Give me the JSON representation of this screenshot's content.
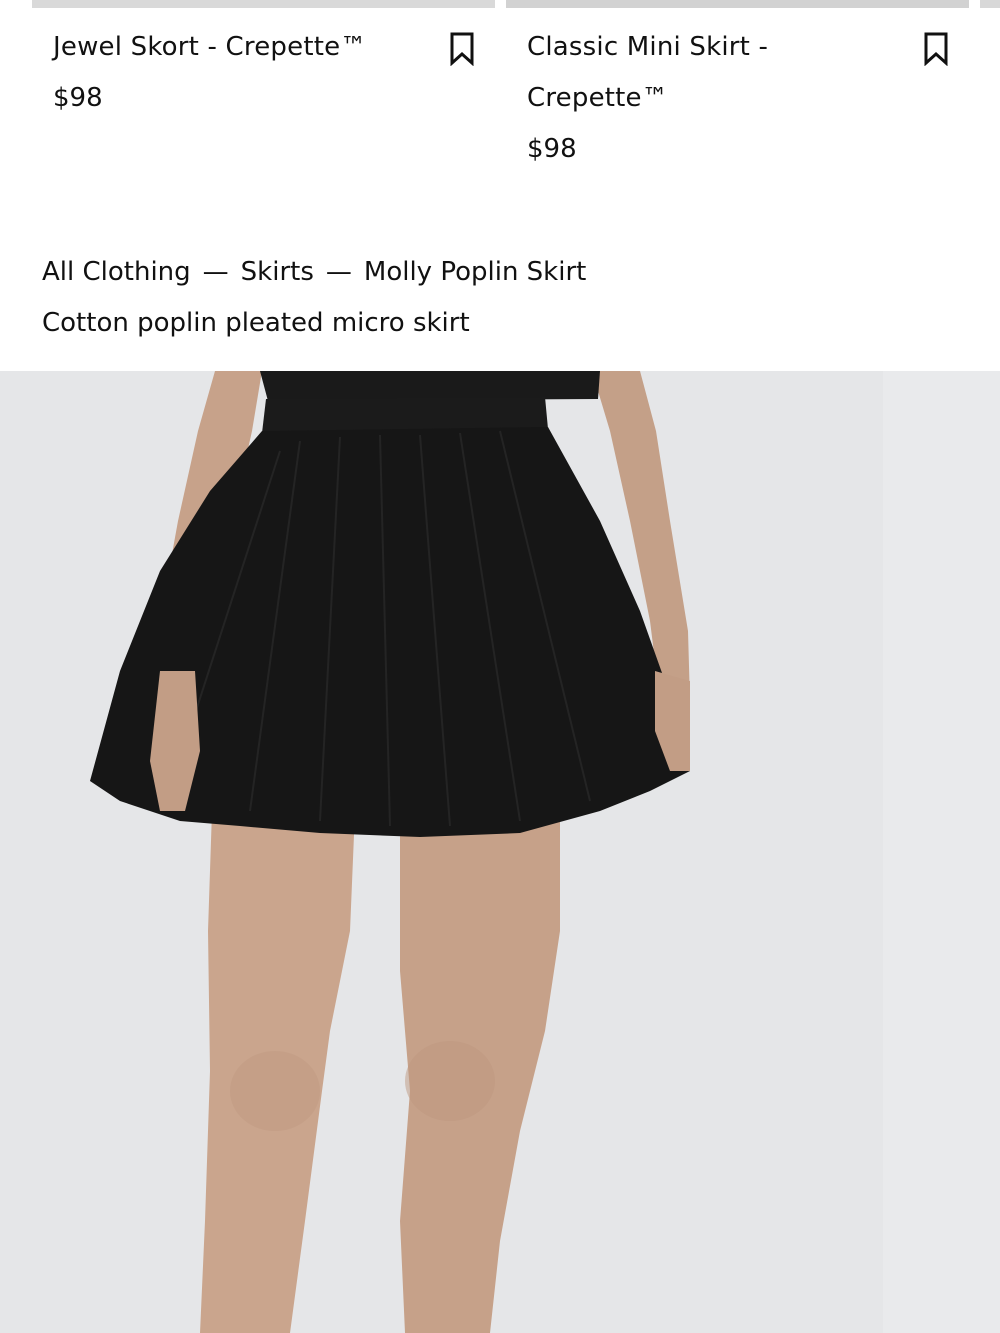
{
  "cards": [
    {
      "title": "Jewel Skort - Crepette™",
      "price": "$98",
      "bookmark_icon": "bookmark-icon"
    },
    {
      "title_line1": "Classic Mini Skirt -",
      "title_line2": "Crepette™",
      "price": "$98",
      "bookmark_icon": "bookmark-icon"
    }
  ],
  "breadcrumb": {
    "items": [
      "All Clothing",
      "Skirts",
      "Molly Poplin Skirt"
    ],
    "separator": "—"
  },
  "product": {
    "subtitle": "Cotton poplin pleated micro skirt"
  },
  "colors": {
    "text": "#111111",
    "image_bg": "#e5e6e8",
    "skirt": "#161616",
    "skin": "#c9a48c"
  }
}
